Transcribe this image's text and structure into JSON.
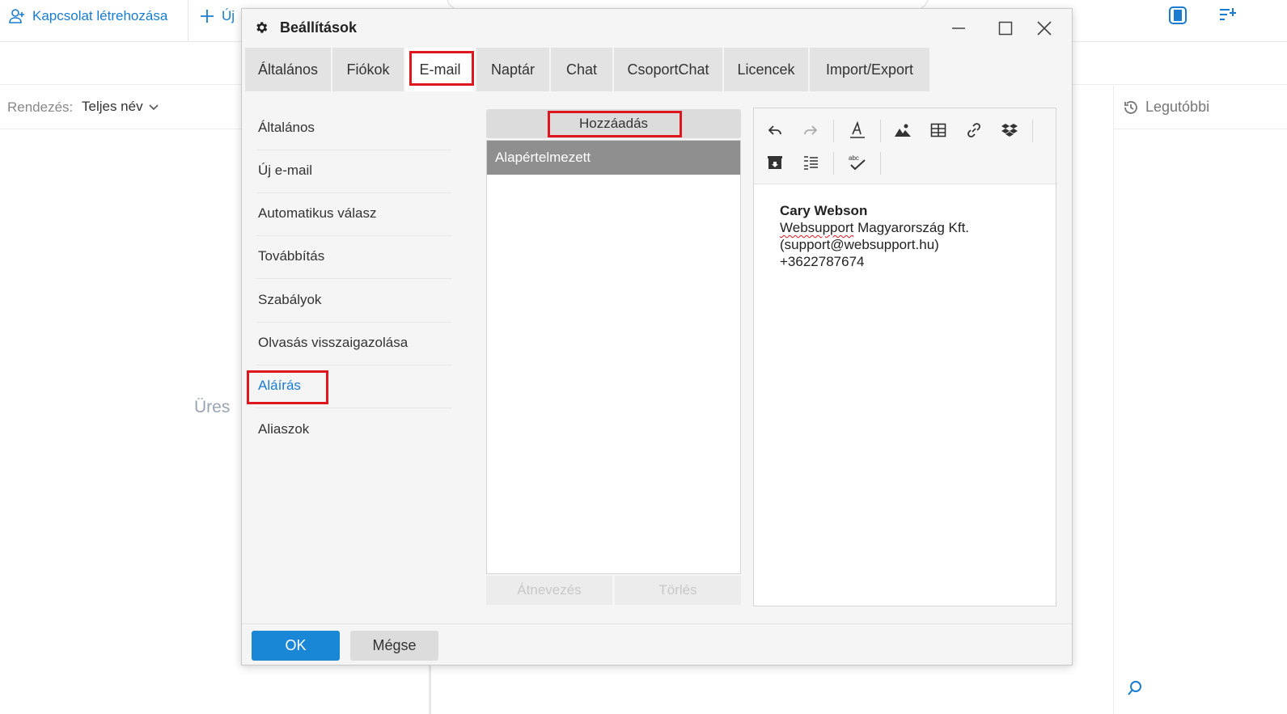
{
  "background": {
    "create_contact_label": "Kapcsolat létrehozása",
    "new_label": "Új",
    "sort_label": "Rendezés:",
    "sort_value": "Teljes név",
    "empty_label": "Üres",
    "recent_label": "Legutóbbi"
  },
  "dialog": {
    "title": "Beállítások",
    "tabs": [
      {
        "label": "Általános"
      },
      {
        "label": "Fiókok"
      },
      {
        "label": "E-mail"
      },
      {
        "label": "Naptár"
      },
      {
        "label": "Chat"
      },
      {
        "label": "CsoportChat"
      },
      {
        "label": "Licencek"
      },
      {
        "label": "Import/Export"
      }
    ],
    "menu": [
      {
        "label": "Általános"
      },
      {
        "label": "Új e-mail"
      },
      {
        "label": "Automatikus válasz"
      },
      {
        "label": "Továbbítás"
      },
      {
        "label": "Szabályok"
      },
      {
        "label": "Olvasás visszaigazolása"
      },
      {
        "label": "Aláírás"
      },
      {
        "label": "Aliaszok"
      }
    ],
    "signatures": {
      "add_label": "Hozzáadás",
      "items": [
        {
          "label": "Alapértelmezett"
        }
      ],
      "rename_label": "Átnevezés",
      "delete_label": "Törlés"
    },
    "editor": {
      "toolbar": [
        "undo-icon",
        "redo-icon",
        "font-icon",
        "image-icon",
        "table-icon",
        "link-icon",
        "dropbox-icon",
        "archive-icon",
        "list-icon",
        "spellcheck-icon"
      ],
      "signature": {
        "name": "Cary Webson",
        "company_word": "Websupport",
        "company_rest": " Magyarország Kft.",
        "email": "(support@websupport.hu)",
        "phone": "+3622787674"
      }
    },
    "footer": {
      "ok_label": "OK",
      "cancel_label": "Mégse"
    }
  },
  "colors": {
    "accent": "#1a7ccf",
    "highlight": "#e0161e",
    "selected_item": "#8f8f8f"
  }
}
